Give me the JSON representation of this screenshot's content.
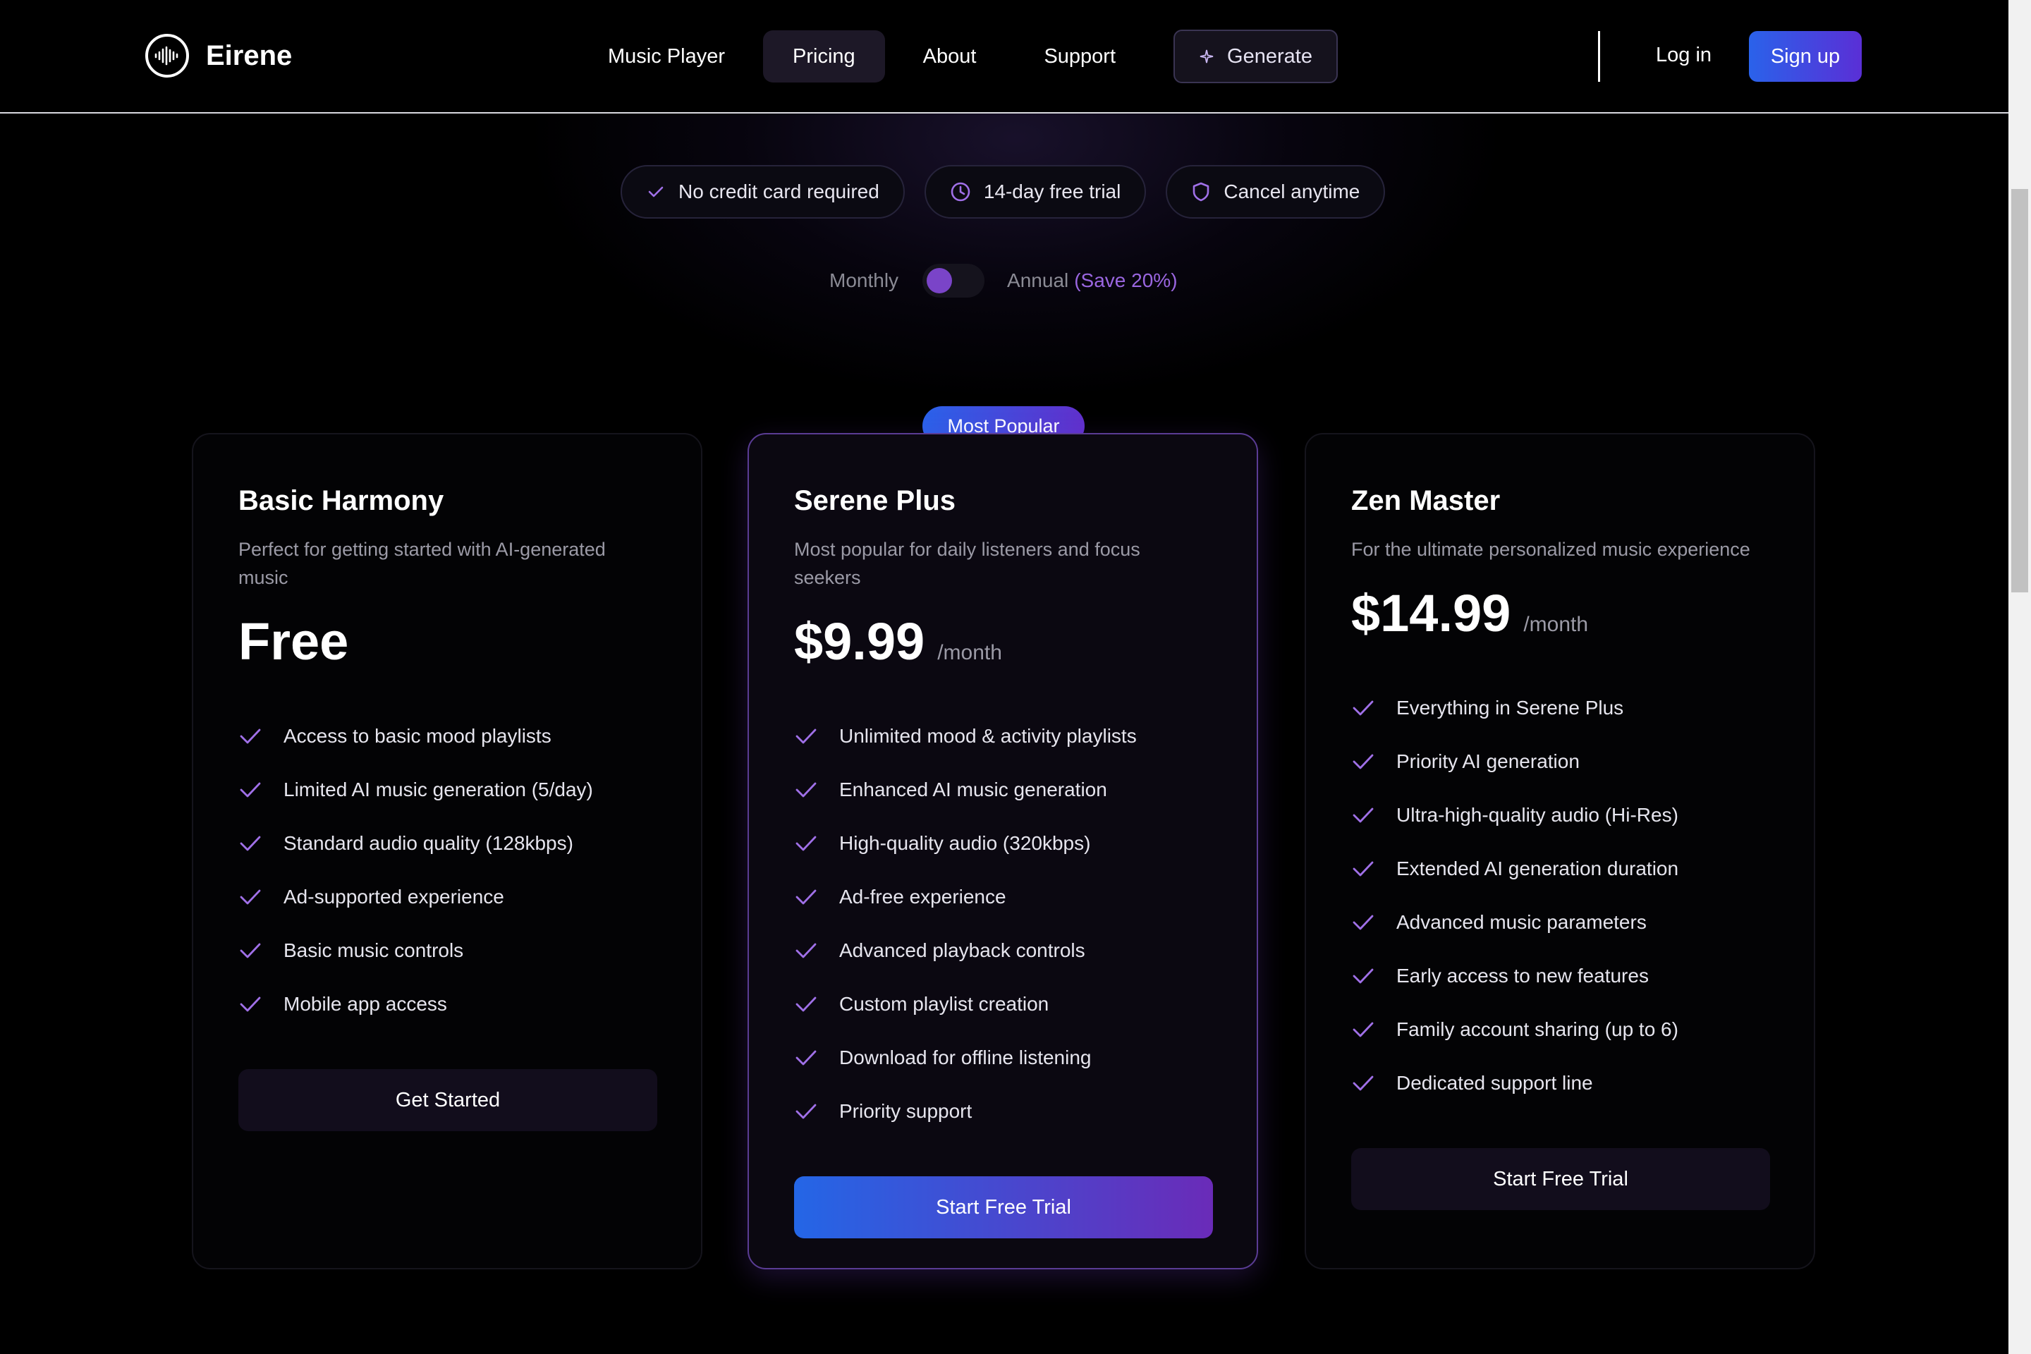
{
  "header": {
    "logo_text": "Eirene",
    "nav": [
      {
        "label": "Music Player",
        "active": false
      },
      {
        "label": "Pricing",
        "active": true
      },
      {
        "label": "About",
        "active": false
      },
      {
        "label": "Support",
        "active": false
      }
    ],
    "generate_label": "Generate",
    "login_label": "Log in",
    "signup_label": "Sign up"
  },
  "badges": [
    {
      "icon": "check-icon",
      "label": "No credit card required"
    },
    {
      "icon": "clock-icon",
      "label": "14-day free trial"
    },
    {
      "icon": "shield-icon",
      "label": "Cancel anytime"
    }
  ],
  "billing": {
    "monthly_label": "Monthly",
    "annual_label": "Annual",
    "save_label": "(Save 20%)",
    "annual_selected": false
  },
  "popular_label": "Most Popular",
  "plans": [
    {
      "name": "Basic Harmony",
      "description": "Perfect for getting started with AI-generated music",
      "price": "Free",
      "period": "",
      "features": [
        "Access to basic mood playlists",
        "Limited AI music generation (5/day)",
        "Standard audio quality (128kbps)",
        "Ad-supported experience",
        "Basic music controls",
        "Mobile app access"
      ],
      "cta": "Get Started"
    },
    {
      "name": "Serene Plus",
      "description": "Most popular for daily listeners and focus seekers",
      "price": "$9.99",
      "period": "/month",
      "features": [
        "Unlimited mood & activity playlists",
        "Enhanced AI music generation",
        "High-quality audio (320kbps)",
        "Ad-free experience",
        "Advanced playback controls",
        "Custom playlist creation",
        "Download for offline listening",
        "Priority support"
      ],
      "cta": "Start Free Trial"
    },
    {
      "name": "Zen Master",
      "description": "For the ultimate personalized music experience",
      "price": "$14.99",
      "period": "/month",
      "features": [
        "Everything in Serene Plus",
        "Priority AI generation",
        "Ultra-high-quality audio (Hi-Res)",
        "Extended AI generation duration",
        "Advanced music parameters",
        "Early access to new features",
        "Family account sharing (up to 6)",
        "Dedicated support line"
      ],
      "cta": "Start Free Trial"
    }
  ],
  "colors": {
    "accent_purple": "#9a66e0",
    "gradient_start": "#2a62ea",
    "gradient_end": "#6130cc",
    "check_color": "#a070e8"
  }
}
